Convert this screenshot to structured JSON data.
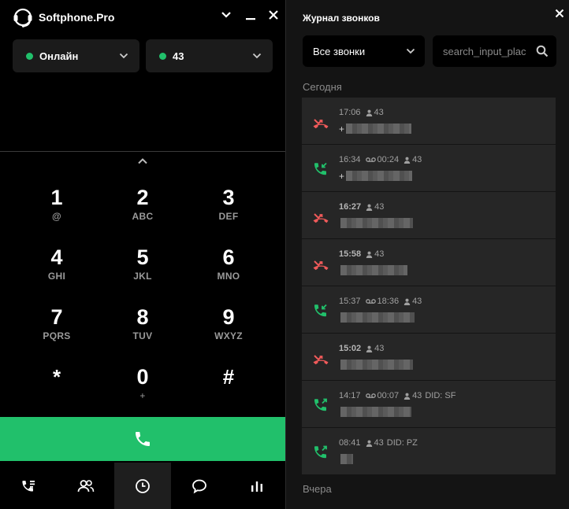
{
  "app": {
    "title": "Softphone.Pro",
    "status": {
      "label": "Онлайн",
      "color": "#21c06b"
    },
    "account": {
      "label": "43",
      "color": "#21c06b"
    },
    "icons": {
      "logo": "headset-icon",
      "minimize": "chevron-down-icon",
      "hide": "minimize-icon",
      "close": "close-icon"
    }
  },
  "dialpad": {
    "keys": [
      {
        "digit": "1",
        "letters": "@"
      },
      {
        "digit": "2",
        "letters": "ABC"
      },
      {
        "digit": "3",
        "letters": "DEF"
      },
      {
        "digit": "4",
        "letters": "GHI"
      },
      {
        "digit": "5",
        "letters": "JKL"
      },
      {
        "digit": "6",
        "letters": "MNO"
      },
      {
        "digit": "7",
        "letters": "PQRS"
      },
      {
        "digit": "8",
        "letters": "TUV"
      },
      {
        "digit": "9",
        "letters": "WXYZ"
      },
      {
        "digit": "*",
        "letters": ""
      },
      {
        "digit": "0",
        "letters": "+"
      },
      {
        "digit": "#",
        "letters": ""
      }
    ],
    "call_button_color": "#21c06b"
  },
  "bottom_nav": [
    {
      "name": "calls-icon",
      "active": false
    },
    {
      "name": "contacts-icon",
      "active": false
    },
    {
      "name": "history-icon",
      "active": true
    },
    {
      "name": "chat-icon",
      "active": false
    },
    {
      "name": "stats-icon",
      "active": false
    }
  ],
  "journal": {
    "title": "Журнал звонков",
    "filter": {
      "selected": "Все звонки"
    },
    "search": {
      "placeholder": "search_input_placeholder"
    },
    "sections": {
      "today": "Сегодня",
      "yesterday": "Вчера"
    },
    "colors": {
      "missed": "#f05a5a",
      "answered": "#21c06b"
    },
    "calls": [
      {
        "type": "missed",
        "time": "17:06",
        "bold": false,
        "duration": "",
        "agent": "43",
        "did": "",
        "prefix": "+"
      },
      {
        "type": "incoming",
        "time": "16:34",
        "bold": false,
        "duration": "00:24",
        "agent": "43",
        "did": "",
        "prefix": "+"
      },
      {
        "type": "missed",
        "time": "16:27",
        "bold": true,
        "duration": "",
        "agent": "43",
        "did": "",
        "prefix": ""
      },
      {
        "type": "missed",
        "time": "15:58",
        "bold": true,
        "duration": "",
        "agent": "43",
        "did": "",
        "prefix": ""
      },
      {
        "type": "incoming",
        "time": "15:37",
        "bold": false,
        "duration": "18:36",
        "agent": "43",
        "did": "",
        "prefix": ""
      },
      {
        "type": "missed",
        "time": "15:02",
        "bold": true,
        "duration": "",
        "agent": "43",
        "did": "",
        "prefix": ""
      },
      {
        "type": "outgoing",
        "time": "14:17",
        "bold": false,
        "duration": "00:07",
        "agent": "43",
        "did": "DID: SF",
        "prefix": ""
      },
      {
        "type": "outgoing",
        "time": "08:41",
        "bold": false,
        "duration": "",
        "agent": "43",
        "did": "DID: PZ",
        "prefix": ""
      }
    ]
  }
}
